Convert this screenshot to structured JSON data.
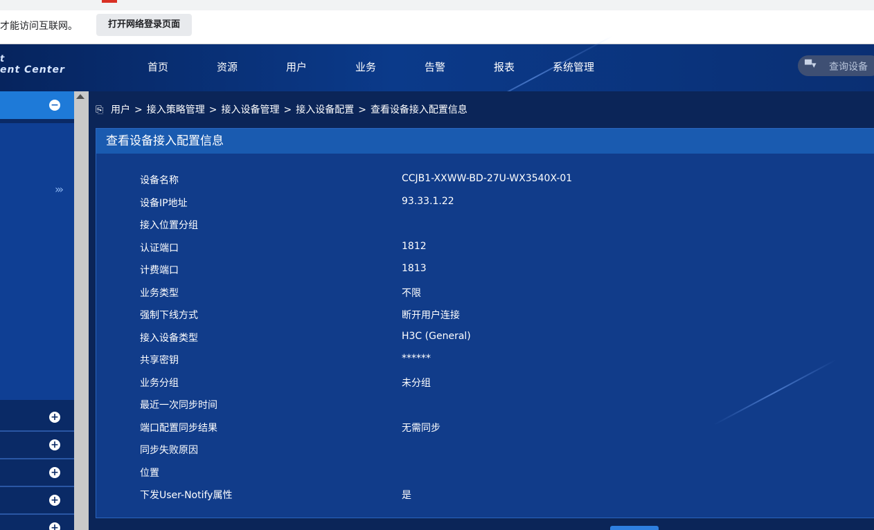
{
  "browser": {
    "info_message": "才能访问互联网。",
    "open_login_button": "打开网络登录页面"
  },
  "header": {
    "logo_line1": "t",
    "logo_line2": "ent Center",
    "nav": [
      "首页",
      "资源",
      "用户",
      "业务",
      "告警",
      "报表",
      "系统管理"
    ],
    "search_placeholder": "查询设备"
  },
  "sidebar": {
    "expand_symbol": "›››",
    "collapse_symbol": "−",
    "plus_symbol": "+"
  },
  "breadcrumb": {
    "items": [
      "用户",
      "接入策略管理",
      "接入设备管理",
      "接入设备配置",
      "查看设备接入配置信息"
    ],
    "separator": ">"
  },
  "panel": {
    "title": "查看设备接入配置信息",
    "rows": [
      {
        "label": "设备名称",
        "value": "CCJB1-XXWW-BD-27U-WX3540X-01"
      },
      {
        "label": "设备IP地址",
        "value": "93.33.1.22"
      },
      {
        "label": "接入位置分组",
        "value": ""
      },
      {
        "label": "认证端口",
        "value": "1812"
      },
      {
        "label": "计费端口",
        "value": "1813"
      },
      {
        "label": "业务类型",
        "value": "不限"
      },
      {
        "label": "强制下线方式",
        "value": "断开用户连接"
      },
      {
        "label": "接入设备类型",
        "value": "H3C (General)"
      },
      {
        "label": "共享密钥",
        "value": "******"
      },
      {
        "label": "业务分组",
        "value": "未分组"
      },
      {
        "label": "最近一次同步时间",
        "value": ""
      },
      {
        "label": "端口配置同步结果",
        "value": "无需同步"
      },
      {
        "label": "同步失败原因",
        "value": ""
      },
      {
        "label": "位置",
        "value": ""
      },
      {
        "label": "下发User-Notify属性",
        "value": "是"
      }
    ]
  },
  "colors": {
    "header_bg": "#0b3a8a",
    "panel_bg": "#113c8a",
    "panel_title_bg": "#1a5bb0",
    "sidebar_active": "#1e7ad8"
  }
}
